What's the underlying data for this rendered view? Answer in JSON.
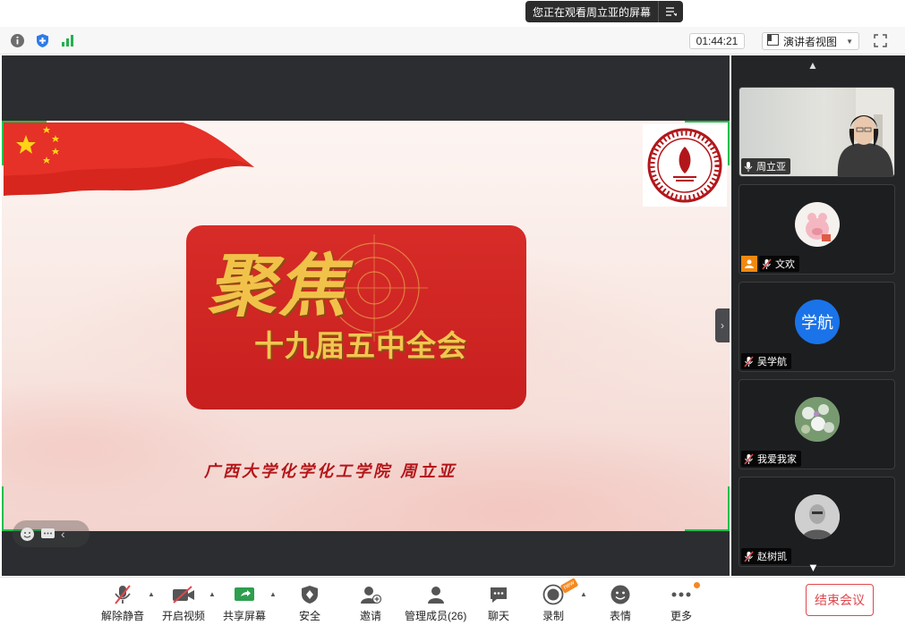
{
  "banner": {
    "text": "您正在观看周立亚的屏幕"
  },
  "topbar": {
    "icons": [
      "info-icon",
      "shield-icon",
      "signal-icon"
    ],
    "timer": "01:44:21",
    "view_label": "演讲者视图"
  },
  "slide": {
    "title_big": "聚焦",
    "title_sub": "十九届五中全会",
    "author": "广西大学化学化工学院  周立亚"
  },
  "gallery": {
    "participants": [
      {
        "name": "周立亚",
        "type": "video"
      },
      {
        "name": "文欢",
        "type": "avatar"
      },
      {
        "name": "吴学航",
        "type": "avatar",
        "initials": "学航",
        "color": "#1a73e8"
      },
      {
        "name": "我爱我家",
        "type": "avatar"
      },
      {
        "name": "赵树凯",
        "type": "avatar"
      }
    ]
  },
  "controls": {
    "mute": "解除静音",
    "video": "开启视频",
    "share": "共享屏幕",
    "security": "安全",
    "invite": "邀请",
    "members": "管理成员(26)",
    "chat": "聊天",
    "record": "录制",
    "reactions": "表情",
    "more": "更多",
    "end": "结束会议",
    "new_badge": "new"
  },
  "colors": {
    "accent_green": "#1fbf4b",
    "end_red": "#e0474c",
    "slide_red": "#c81f1f",
    "gold": "#f1c24a"
  }
}
